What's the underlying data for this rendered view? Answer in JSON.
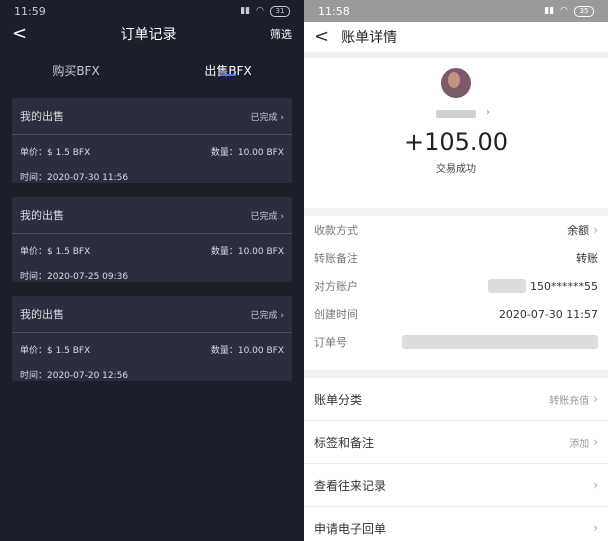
{
  "left": {
    "status": {
      "time": "11:59",
      "battery": "31"
    },
    "nav": {
      "back": "<",
      "title": "订单记录",
      "filter": "筛选"
    },
    "tabs": [
      {
        "label": "购买BFX"
      },
      {
        "label": "出售BFX"
      }
    ],
    "orders": [
      {
        "title": "我的出售",
        "status": "已完成",
        "price": "单价：$ 1.5 BFX",
        "qty": "数量：10.00 BFX",
        "time": "时间：2020-07-30 11:56"
      },
      {
        "title": "我的出售",
        "status": "已完成",
        "price": "单价：$ 1.5 BFX",
        "qty": "数量：10.00 BFX",
        "time": "时间：2020-07-25 09:36"
      },
      {
        "title": "我的出售",
        "status": "已完成",
        "price": "单价：$ 1.5 BFX",
        "qty": "数量：10.00 BFX",
        "time": "时间：2020-07-20 12:56"
      }
    ]
  },
  "right": {
    "status": {
      "time": "11:58",
      "battery": "35"
    },
    "nav": {
      "back": "<",
      "title": "账单详情"
    },
    "amount": "+105.00",
    "amount_sub": "交易成功",
    "details": [
      {
        "label": "收款方式",
        "value": "余额"
      },
      {
        "label": "转账备注",
        "value": "转账"
      },
      {
        "label": "对方账户",
        "value": "150******55"
      },
      {
        "label": "创建时间",
        "value": "2020-07-30 11:57"
      },
      {
        "label": "订单号",
        "value": ""
      }
    ],
    "list": [
      {
        "label": "账单分类",
        "value": "转账充值"
      },
      {
        "label": "标签和备注",
        "value": "添加"
      },
      {
        "label": "查看往来记录",
        "value": ""
      },
      {
        "label": "申请电子回单",
        "value": ""
      }
    ]
  },
  "colors": {
    "accent": "#3f7bff",
    "card": "#2b2f3d",
    "bg_dark": "#1c1f2b"
  }
}
